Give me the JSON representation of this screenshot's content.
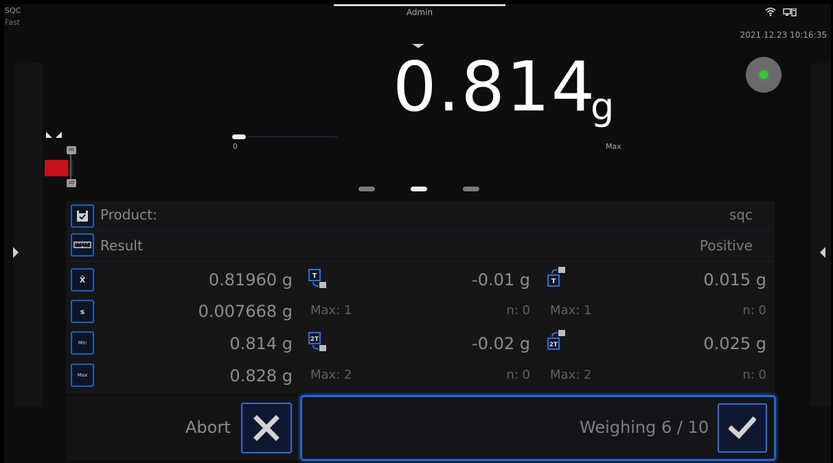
{
  "header": {
    "mode": "SQC",
    "speed": "Fast",
    "user": "Admin",
    "datetime": "2021.12.23 10:16:35"
  },
  "display": {
    "value": "0.814",
    "unit": "g",
    "zero_label": "0",
    "max_label": "Max",
    "bar_hi": "HI",
    "bar_lo": "LO",
    "status_color": "#3bc43b",
    "page_count": 3,
    "page_active_index": 1
  },
  "info": {
    "product_label": "Product:",
    "product_value": "sqc",
    "result_label": "Result",
    "result_value": "Positive",
    "stats": [
      {
        "icon": "X̄",
        "value": "0.81960 g"
      },
      {
        "icon": "s",
        "value": "0.007668 g"
      },
      {
        "icon": "Min",
        "value": "0.814 g"
      },
      {
        "icon": "Max",
        "value": "0.828 g"
      }
    ],
    "t_lo": {
      "value": "-0.01 g",
      "max": "Max: 1",
      "n": "n: 0"
    },
    "t_hi": {
      "value": "0.015 g",
      "max": "Max: 1",
      "n": "n: 0"
    },
    "t2_lo": {
      "value": "-0.02 g",
      "max": "Max: 2",
      "n": "n: 0"
    },
    "t2_hi": {
      "value": "0.025 g",
      "max": "Max: 2",
      "n": "n: 0"
    }
  },
  "actions": {
    "abort_label": "Abort",
    "confirm_label": "Weighing 6 / 10"
  },
  "colors": {
    "accent": "#1f67d6",
    "bar_red": "#c6101a"
  }
}
